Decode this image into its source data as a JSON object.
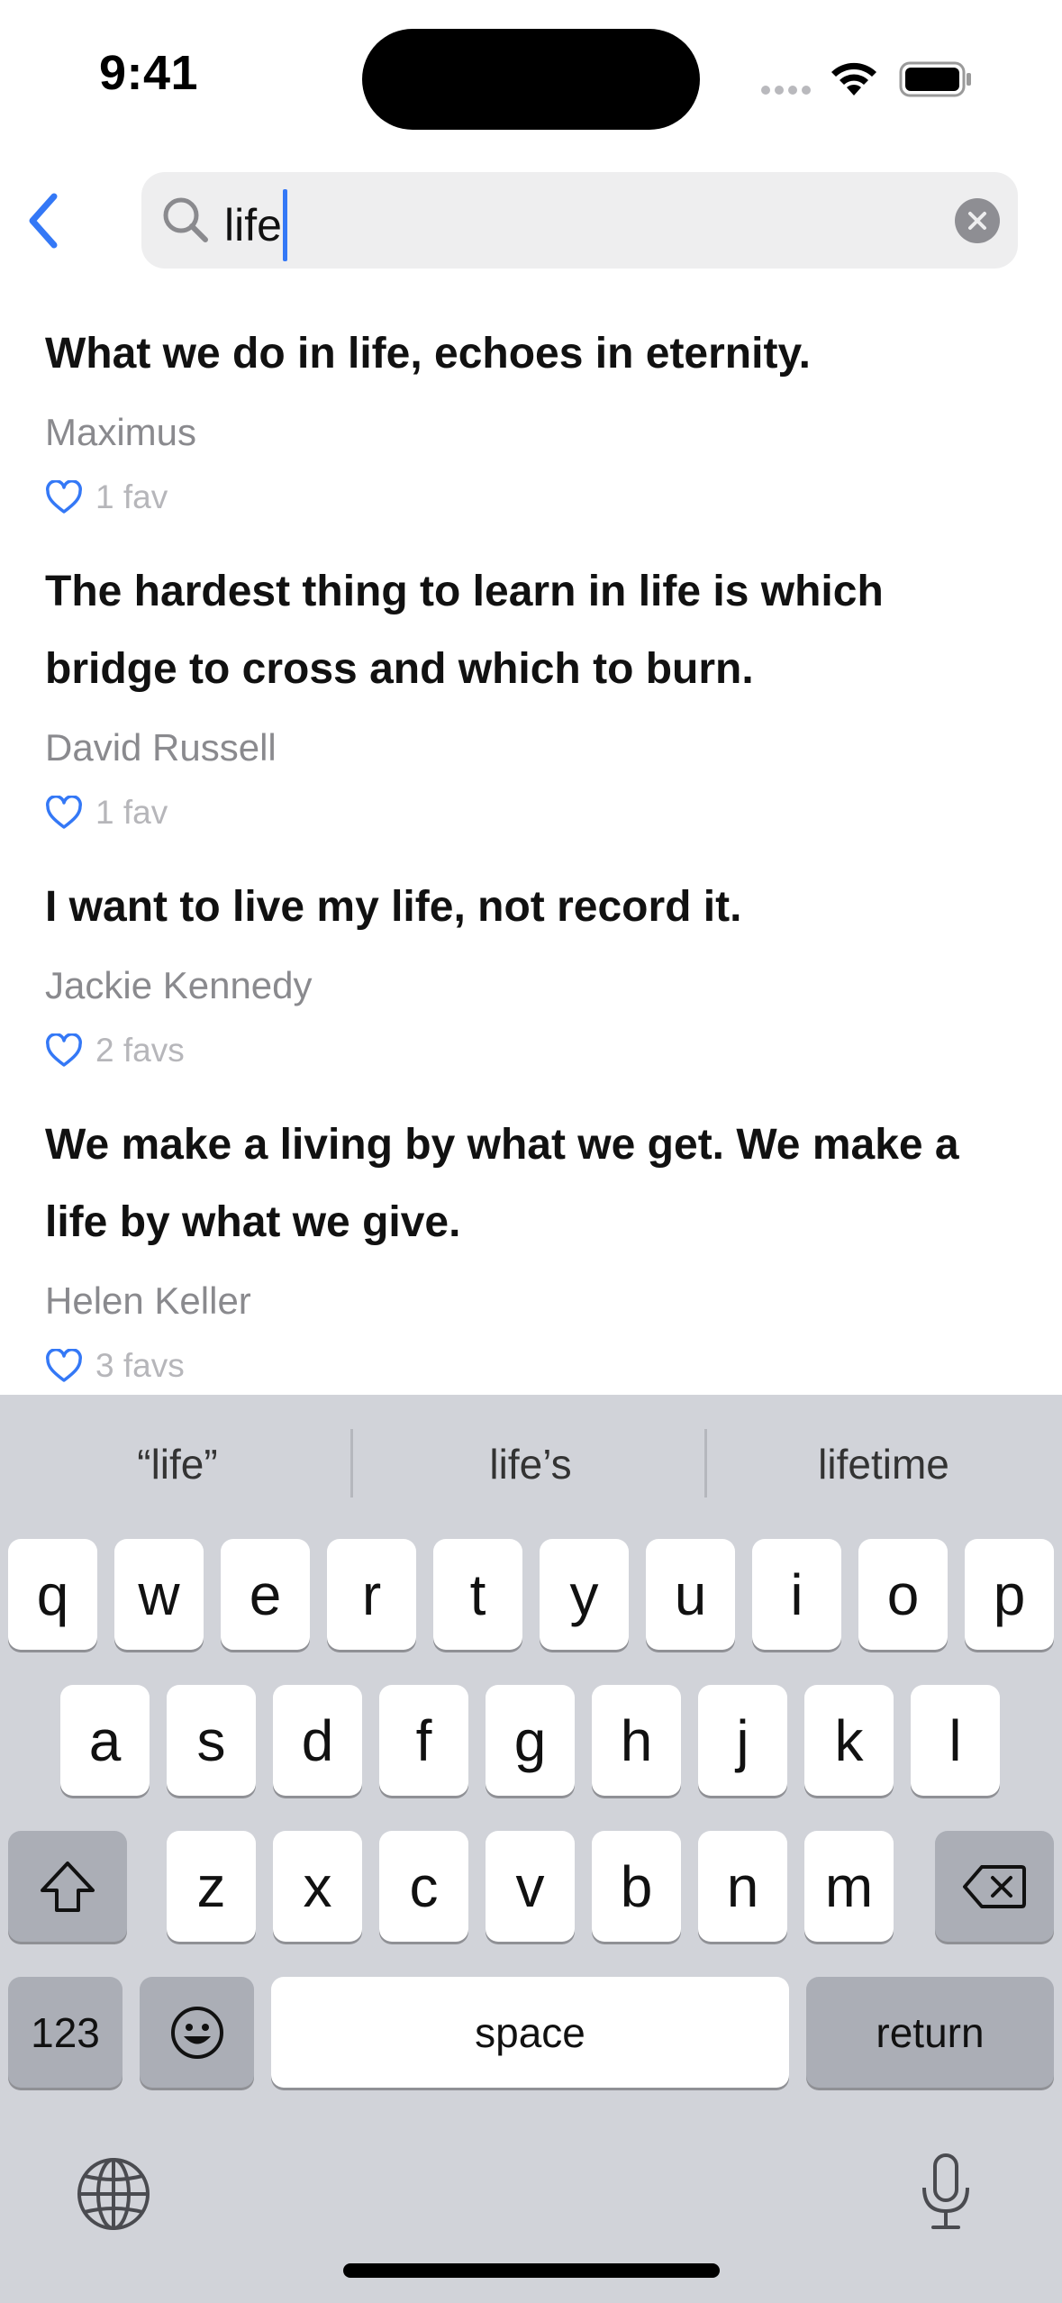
{
  "status_bar": {
    "time": "9:41"
  },
  "search": {
    "query": "life"
  },
  "results": [
    {
      "text": "What we do in life, echoes in eternity.",
      "author": "Maximus",
      "favs": "1 fav"
    },
    {
      "text": "The hardest thing to learn in life is which bridge to cross and which to burn.",
      "author": "David Russell",
      "favs": "1 fav"
    },
    {
      "text": "I want to live my life, not record it.",
      "author": "Jackie Kennedy",
      "favs": "2 favs"
    },
    {
      "text": "We make a living by what we get. We make a life by what we give.",
      "author": "Helen Keller",
      "favs": "3 favs"
    }
  ],
  "keyboard": {
    "suggestions": [
      "“life”",
      "life’s",
      "lifetime"
    ],
    "row1": [
      "q",
      "w",
      "e",
      "r",
      "t",
      "y",
      "u",
      "i",
      "o",
      "p"
    ],
    "row2": [
      "a",
      "s",
      "d",
      "f",
      "g",
      "h",
      "j",
      "k",
      "l"
    ],
    "row3": [
      "z",
      "x",
      "c",
      "v",
      "b",
      "n",
      "m"
    ],
    "numbers_label": "123",
    "space_label": "space",
    "return_label": "return"
  },
  "icons": {
    "back": "chevron-left-icon",
    "search": "magnifier-icon",
    "clear": "clear-x-icon",
    "fav": "heart-outline-icon",
    "shift": "shift-icon",
    "delete": "delete-icon",
    "emoji": "emoji-icon",
    "globe": "globe-icon",
    "mic": "microphone-icon"
  },
  "colors": {
    "accent": "#3478f6",
    "keyboard_bg": "#d1d3d9",
    "search_bg": "#eeeeef"
  }
}
